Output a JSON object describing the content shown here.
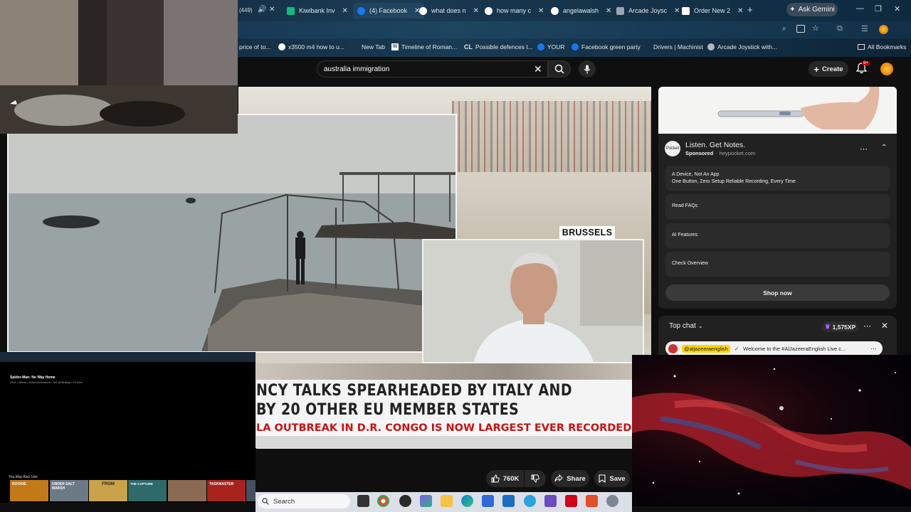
{
  "browser": {
    "tab_counter": "(449)",
    "tabs": [
      {
        "label": "Kiwibank Inv",
        "fav": "#0bbf7a"
      },
      {
        "label": "(4) Facebook",
        "fav": "#1877f2"
      },
      {
        "label": "what does n",
        "fav": "#ffffff"
      },
      {
        "label": "how many c",
        "fav": "#ffffff"
      },
      {
        "label": "angelawalsh",
        "fav": "#ffffff"
      },
      {
        "label": "Arcade Joysc",
        "fav": "#9aa6b2"
      },
      {
        "label": "Order New 2",
        "fav": "#ffffff"
      }
    ],
    "ask_gemini": "Ask Gemini",
    "bookmarks": [
      {
        "label": "price of to...",
        "icon": "none"
      },
      {
        "label": "x3500 m4 how to u...",
        "icon": "google-icon"
      },
      {
        "label": "New Tab",
        "icon": "none"
      },
      {
        "label": "Timeline of Roman...",
        "icon": "wikipedia-icon"
      },
      {
        "label": "Possible defences t...",
        "icon": "cl-icon"
      },
      {
        "label": "YOUR",
        "icon": "facebook-icon"
      },
      {
        "label": "Facebook green party",
        "icon": "facebook-icon"
      },
      {
        "label": "Drivers | Machinist",
        "icon": "none"
      },
      {
        "label": "Arcade Joystick with...",
        "icon": "joystick-icon"
      }
    ],
    "all_bookmarks": "All Bookmarks"
  },
  "youtube": {
    "search_value": "australia immigration",
    "create_label": "Create",
    "notif_badge": "9+",
    "video": {
      "location_tag": "BRUSSELS",
      "headline_line1": "NCY TALKS SPEARHEADED BY ITALY AND",
      "headline_line2": "BY 20 OTHER EU MEMBER STATES",
      "ticker": "LA OUTBREAK IN D.R. CONGO IS NOW LARGEST EVER RECORDED AND IS I"
    },
    "actions": {
      "likes": "760K",
      "share": "Share",
      "save": "Save"
    },
    "ad": {
      "title": "Listen. Get Notes.",
      "sponsored": "Sponsored",
      "domain": "heypocket.com",
      "logo_text": "Pocket",
      "rows": [
        {
          "title": "A Device, Not An App",
          "sub": "One Button, Zero Setup Reliable Recording, Every Time"
        },
        {
          "title": "Read FAQs",
          "sub": ""
        },
        {
          "title": "AI Features",
          "sub": ""
        },
        {
          "title": "Check Overview",
          "sub": ""
        }
      ],
      "shop_now": "Shop now"
    },
    "chat": {
      "title": "Top chat",
      "xp": "1,575XP",
      "message_author": "@aljazeeraenglish",
      "message_text": "Welcome to the #AlJazeeraEnglish Live c..."
    }
  },
  "netflix_overlay": {
    "title": "Spider-Man: No Way Home",
    "meta": "2021 • Movie • Action/Adventure • Sci-fi/Fantasy • 2h 30m",
    "section": "You May Also Like",
    "thumbnails": [
      {
        "label": "ROOKIE",
        "color": "#c27a18"
      },
      {
        "label": "UNDER SALT MARSH",
        "color": "#6c7a86"
      },
      {
        "label": "FROM",
        "color": "#c9a24a"
      },
      {
        "label": "THE CAPTURE",
        "color": "#2e6a6a"
      },
      {
        "label": "",
        "color": "#8a6a52"
      },
      {
        "label": "TASKMASTER",
        "color": "#a8221e"
      },
      {
        "label": "",
        "color": "#44505e"
      }
    ]
  },
  "taskbar": {
    "search_label": "Search"
  }
}
